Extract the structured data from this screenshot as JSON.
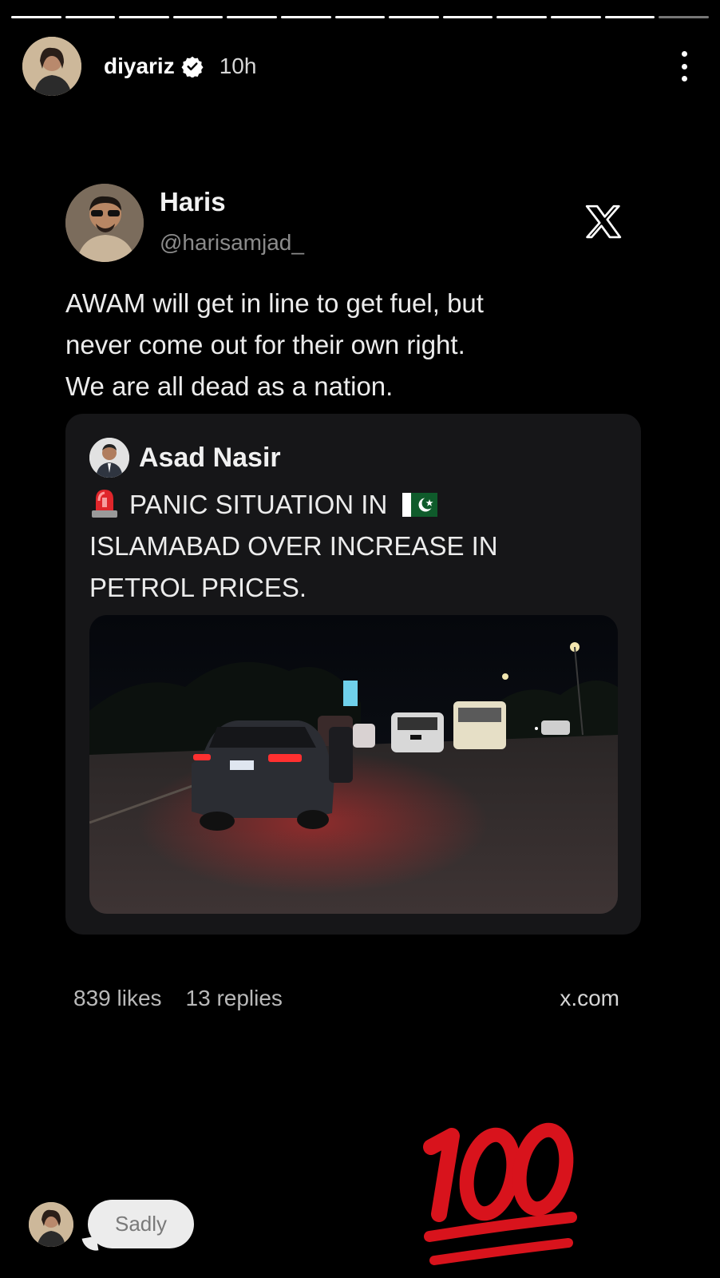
{
  "story": {
    "username": "diyariz",
    "time": "10h",
    "progress_segments": 13,
    "progress_dim_segments": 1
  },
  "tweet": {
    "name": "Haris",
    "handle": "@harisamjad_",
    "text_lines": [
      "AWAM will get in line to get fuel, but",
      "never come out for their own right.",
      "We are all dead as a nation."
    ],
    "platform_icon": "x-logo-icon"
  },
  "quote": {
    "name": "Asad Nasir",
    "line1": "PANIC SITUATION IN",
    "line2": "ISLAMABAD OVER INCREASE IN",
    "line3": "PETROL PRICES.",
    "leading_emoji": "rotating-light",
    "flag_emoji": "pakistan-flag"
  },
  "stats": {
    "likes": "839 likes",
    "replies": "13 replies",
    "site": "x.com"
  },
  "sticker": "hundred-points-emoji",
  "reply": {
    "bubble_text": "Sadly"
  },
  "colors": {
    "background": "#000000",
    "quote_card": "#161618",
    "muted_text": "#8b8b8b",
    "emoji_red": "#d8131c"
  }
}
